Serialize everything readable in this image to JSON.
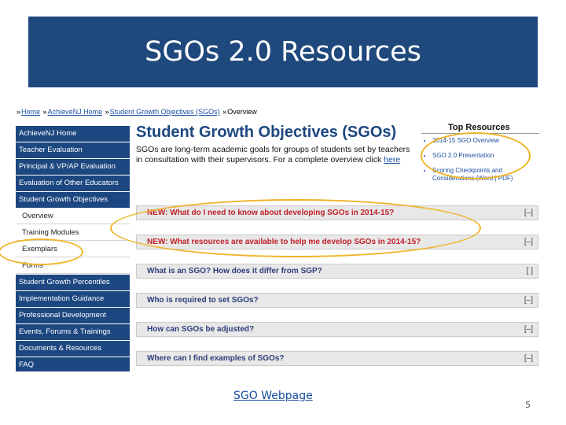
{
  "slide": {
    "title": "SGOs 2.0 Resources",
    "footer_link": "SGO Webpage",
    "page_number": "5"
  },
  "breadcrumb": [
    {
      "prefix": "»",
      "label": "Home"
    },
    {
      "prefix": "»",
      "label": "AchieveNJ Home"
    },
    {
      "prefix": "»",
      "label": "Student Growth Objectives (SGOs)"
    },
    {
      "prefix": "»",
      "label": "Overview"
    }
  ],
  "sidebar": {
    "items": [
      {
        "label": "AchieveNJ Home",
        "style": "dark"
      },
      {
        "label": "Teacher Evaluation",
        "style": "dark"
      },
      {
        "label": "Principal & VP/AP Evaluation",
        "style": "dark"
      },
      {
        "label": "Evaluation of Other Educators",
        "style": "dark"
      },
      {
        "label": "Student Growth Objectives",
        "style": "dark"
      },
      {
        "label": "Overview",
        "style": "sub"
      },
      {
        "label": "Training Modules",
        "style": "sub"
      },
      {
        "label": "Exemplars",
        "style": "sub"
      },
      {
        "label": "Forms",
        "style": "sub"
      },
      {
        "label": "Student Growth Percentiles",
        "style": "dark"
      },
      {
        "label": "Implementation Guidance",
        "style": "dark"
      },
      {
        "label": "Professional Development",
        "style": "dark"
      },
      {
        "label": "Events, Forums & Trainings",
        "style": "dark"
      },
      {
        "label": "Documents & Resources",
        "style": "dark"
      },
      {
        "label": "FAQ",
        "style": "dark"
      }
    ]
  },
  "main": {
    "title": "Student Growth Objectives (SGOs)",
    "intro": "SGOs are long-term academic goals for groups of students set by teachers in consultation with their supervisors. For a complete overview click",
    "intro_link": "here"
  },
  "top_resources": {
    "heading": "Top Resources",
    "items": [
      "2014-15 SGO Overview",
      "SGO 2.0 Presentation",
      "Scoring Checkpoints and Considerations (Word | PDF)"
    ]
  },
  "faqs": [
    {
      "q": "NEW: What do I need to know about developing SGOs in 2014-15?",
      "toggle": "[–]",
      "color": "red"
    },
    {
      "q": "NEW: What resources are available to help me develop SGOs in 2014-15?",
      "toggle": "[–]",
      "color": "red"
    },
    {
      "q": "What is an SGO? How does it differ from SGP?",
      "toggle": "[ ]",
      "color": "blue"
    },
    {
      "q": "Who is required to set SGOs?",
      "toggle": "[–]",
      "color": "blue"
    },
    {
      "q": "How can SGOs be adjusted?",
      "toggle": "[–]",
      "color": "blue"
    },
    {
      "q": "Where can I find examples of SGOs?",
      "toggle": "[–]",
      "color": "blue"
    }
  ],
  "colors": {
    "title_bar": "#1f497d",
    "nav_dark": "#1c4780",
    "highlight_ring": "#f0b429",
    "faq_new": "#c0202a"
  }
}
